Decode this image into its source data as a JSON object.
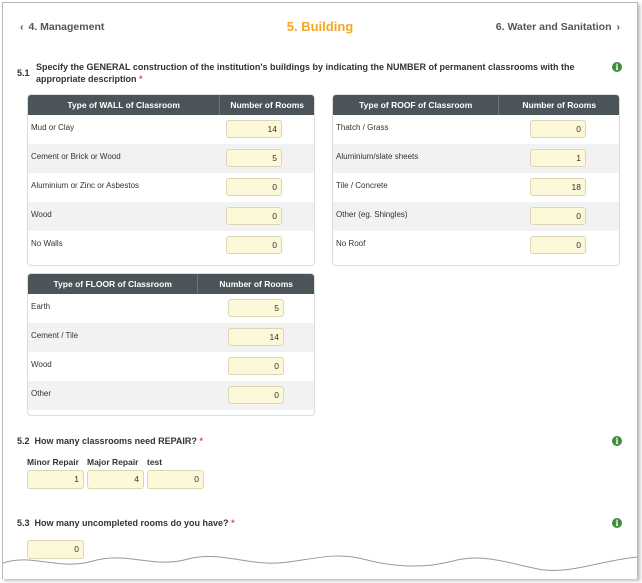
{
  "nav": {
    "prev_label": "4. Management",
    "current_label": "5. Building",
    "next_label": "6. Water and Sanitation"
  },
  "q51": {
    "number": "5.1",
    "text": "Specify the GENERAL construction of the institution's buildings by indicating the NUMBER of permanent classrooms with the appropriate description",
    "required_mark": "*"
  },
  "wall_table": {
    "col1": "Type of WALL of Classroom",
    "col2": "Number of Rooms",
    "rows": [
      {
        "label": "Mud or Clay",
        "value": "14"
      },
      {
        "label": "Cement or Brick or Wood",
        "value": "5"
      },
      {
        "label": "Aluminium or Zinc or Asbestos",
        "value": "0"
      },
      {
        "label": "Wood",
        "value": "0"
      },
      {
        "label": "No Walls",
        "value": "0"
      }
    ]
  },
  "roof_table": {
    "col1": "Type of ROOF of Classroom",
    "col2": "Number of Rooms",
    "rows": [
      {
        "label": "Thatch / Grass",
        "value": "0"
      },
      {
        "label": "Aluminium/slate sheets",
        "value": "1"
      },
      {
        "label": "Tile / Concrete",
        "value": "18"
      },
      {
        "label": "Other (eg. Shingles)",
        "value": "0"
      },
      {
        "label": "No Roof",
        "value": "0"
      }
    ]
  },
  "floor_table": {
    "col1": "Type of FLOOR of Classroom",
    "col2": "Number of Rooms",
    "rows": [
      {
        "label": "Earth",
        "value": "5"
      },
      {
        "label": "Cement / Tile",
        "value": "14"
      },
      {
        "label": "Wood",
        "value": "0"
      },
      {
        "label": "Other",
        "value": "0"
      }
    ]
  },
  "q52": {
    "number": "5.2",
    "text": "How many classrooms need REPAIR?",
    "required_mark": "*",
    "fields": [
      {
        "label": "Minor Repair",
        "value": "1"
      },
      {
        "label": "Major Repair",
        "value": "4"
      },
      {
        "label": "test",
        "value": "0"
      }
    ]
  },
  "q53": {
    "number": "5.3",
    "text": "How many uncompleted rooms do you have?",
    "required_mark": "*",
    "value": "0"
  },
  "colors": {
    "accent": "#f5a623",
    "header_bg": "#4b5559",
    "input_bg": "#fcf8d8",
    "info": "#3c8d3c",
    "required": "#d9534f"
  },
  "icons": {
    "info": "i",
    "prev": "‹",
    "next": "›"
  }
}
